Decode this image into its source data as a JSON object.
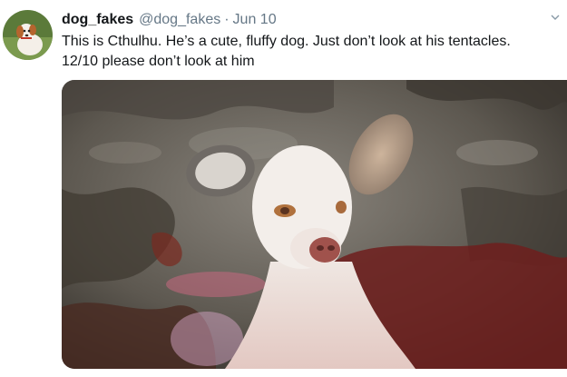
{
  "author": {
    "display_name": "dog_fakes",
    "handle": "@dog_fakes",
    "separator": "·",
    "date": "Jun 10"
  },
  "tweet": {
    "line1": "This is Cthulhu. He’s a cute, fluffy dog. Just don’t look at his tentacles.",
    "line2": "12/10 please don’t look at him"
  },
  "icons": {
    "menu": "chevron-down-icon"
  },
  "colors": {
    "name_text": "#14171a",
    "secondary_text": "#657786"
  }
}
